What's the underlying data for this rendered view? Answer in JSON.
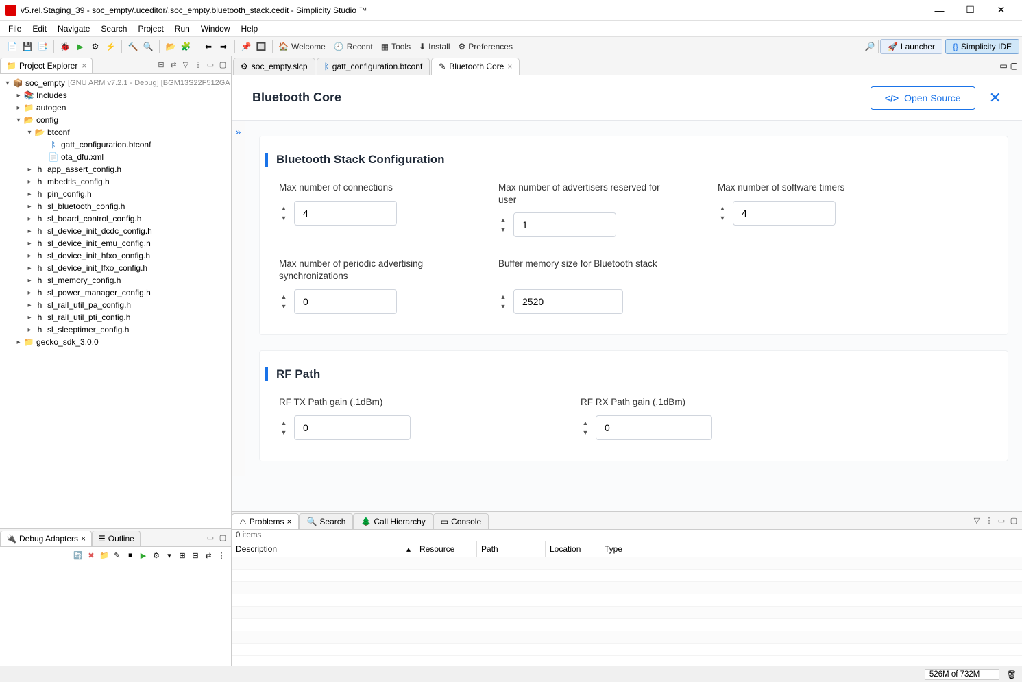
{
  "window": {
    "title": "v5.rel.Staging_39 - soc_empty/.uceditor/.soc_empty.bluetooth_stack.cedit - Simplicity Studio ™"
  },
  "menu": [
    "File",
    "Edit",
    "Navigate",
    "Search",
    "Project",
    "Run",
    "Window",
    "Help"
  ],
  "toolbar_right": {
    "launcher": "Launcher",
    "simplicity_ide": "Simplicity IDE"
  },
  "welcome_links": {
    "welcome": "Welcome",
    "recent": "Recent",
    "tools": "Tools",
    "install": "Install",
    "preferences": "Preferences"
  },
  "project_explorer": {
    "title": "Project Explorer",
    "root": "soc_empty",
    "root_deco": "[GNU ARM v7.2.1 - Debug] [BGM13S22F512GA",
    "items": {
      "includes": "Includes",
      "autogen": "autogen",
      "config": "config",
      "btconf": "btconf",
      "gatt_configuration": "gatt_configuration.btconf",
      "ota_dfu": "ota_dfu.xml",
      "app_assert": "app_assert_config.h",
      "mbedtls": "mbedtls_config.h",
      "pin": "pin_config.h",
      "sl_bluetooth": "sl_bluetooth_config.h",
      "sl_board_control": "sl_board_control_config.h",
      "sl_device_init_dcdc": "sl_device_init_dcdc_config.h",
      "sl_device_init_emu": "sl_device_init_emu_config.h",
      "sl_device_init_hfxo": "sl_device_init_hfxo_config.h",
      "sl_device_init_lfxo": "sl_device_init_lfxo_config.h",
      "sl_memory": "sl_memory_config.h",
      "sl_power_manager": "sl_power_manager_config.h",
      "sl_rail_util_pa": "sl_rail_util_pa_config.h",
      "sl_rail_util_pti": "sl_rail_util_pti_config.h",
      "sl_sleeptimer": "sl_sleeptimer_config.h",
      "gecko_sdk": "gecko_sdk_3.0.0"
    }
  },
  "debug_adapters": {
    "title": "Debug Adapters",
    "outline": "Outline"
  },
  "editor_tabs": {
    "tab1": "soc_empty.slcp",
    "tab2": "gatt_configuration.btconf",
    "tab3": "Bluetooth Core"
  },
  "editor": {
    "title": "Bluetooth Core",
    "open_source": "Open Source",
    "section1": {
      "title": "Bluetooth Stack Configuration",
      "fields": {
        "max_connections": {
          "label": "Max number of connections",
          "value": "4"
        },
        "max_advertisers": {
          "label": "Max number of advertisers reserved for user",
          "value": "1"
        },
        "max_timers": {
          "label": "Max number of software timers",
          "value": "4"
        },
        "max_periodic": {
          "label": "Max number of periodic advertising synchronizations",
          "value": "0"
        },
        "buffer_memory": {
          "label": "Buffer memory size for Bluetooth stack",
          "value": "2520"
        }
      }
    },
    "section2": {
      "title": "RF Path",
      "fields": {
        "rf_tx": {
          "label": "RF TX Path gain (.1dBm)",
          "value": "0"
        },
        "rf_rx": {
          "label": "RF RX Path gain (.1dBm)",
          "value": "0"
        }
      }
    }
  },
  "problems": {
    "tabs": {
      "problems": "Problems",
      "search": "Search",
      "call_hierarchy": "Call Hierarchy",
      "console": "Console"
    },
    "summary": "0 items",
    "columns": {
      "description": "Description",
      "resource": "Resource",
      "path": "Path",
      "location": "Location",
      "type": "Type"
    }
  },
  "statusbar": {
    "memory": "526M of 732M"
  }
}
